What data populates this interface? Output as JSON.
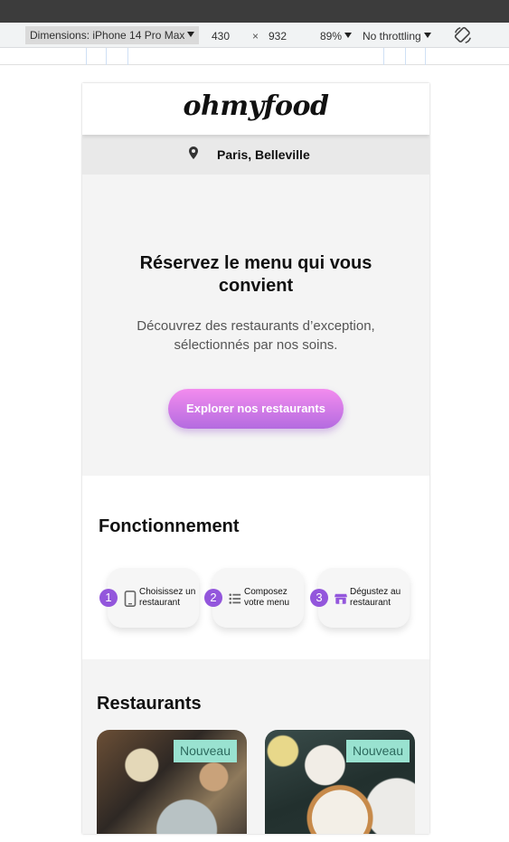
{
  "devtools": {
    "device_label": "Dimensions: iPhone 14 Pro Max",
    "width": "430",
    "times": "×",
    "height": "932",
    "zoom": "89%",
    "throttling": "No throttling"
  },
  "app": {
    "logo": "ohmyfood",
    "location": "Paris, Belleville"
  },
  "hero": {
    "title": "Réservez le menu qui vous convient",
    "subtitle": "Découvrez des restaurants d’exception, sélectionnés par nos soins.",
    "cta": "Explorer nos restaurants"
  },
  "how": {
    "title": "Fonctionnement",
    "steps": [
      {
        "num": "1",
        "icon": "phone-icon",
        "label": "Choisissez un restaurant"
      },
      {
        "num": "2",
        "icon": "list-icon",
        "label": "Composez votre menu"
      },
      {
        "num": "3",
        "icon": "store-icon",
        "label": "Dégustez au restaurant"
      }
    ]
  },
  "restaurants": {
    "title": "Restaurants",
    "cards": [
      {
        "badge": "Nouveau"
      },
      {
        "badge": "Nouveau"
      }
    ]
  },
  "colors": {
    "accent": "#9356dc",
    "cta_top": "#f38cee",
    "cta_bottom": "#b46be0",
    "badge": "#99e2d0"
  }
}
